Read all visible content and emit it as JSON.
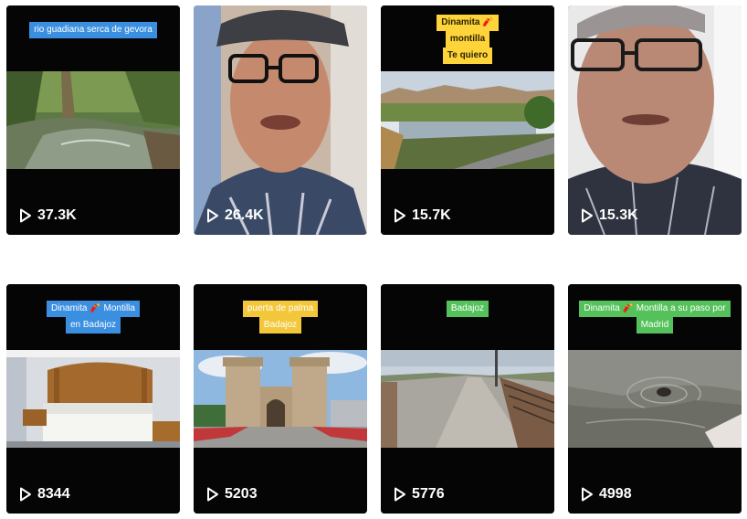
{
  "videos": [
    {
      "caption": [
        "rio guadiana serca de gevora"
      ],
      "caption_style": "blue",
      "views": "37.3K",
      "thumb": "river-forest"
    },
    {
      "caption": [],
      "caption_style": "",
      "views": "26.4K",
      "thumb": "man-selfie-cap"
    },
    {
      "caption": [
        "Dinamita 🧨",
        "montilla",
        "Te quiero"
      ],
      "caption_style": "yellow",
      "views": "15.7K",
      "thumb": "river-city"
    },
    {
      "caption": [],
      "caption_style": "",
      "views": "15.3K",
      "thumb": "man-selfie-close"
    },
    {
      "caption": [
        "Dinamita 🧨 Montilla",
        "en Badajoz"
      ],
      "caption_style": "blue",
      "views": "8344",
      "thumb": "hotel-bed"
    },
    {
      "caption": [
        "puerta de palma",
        "Badajoz"
      ],
      "caption_style": "gold",
      "views": "5203",
      "thumb": "puerta-palma"
    },
    {
      "caption": [
        "Badajoz"
      ],
      "caption_style": "green",
      "views": "5776",
      "thumb": "bridge"
    },
    {
      "caption": [
        "Dinamita 🧨 Montilla a su paso por",
        "Madrid"
      ],
      "caption_style": "green",
      "views": "4998",
      "thumb": "water-duck"
    }
  ],
  "icons": {
    "play": "play-icon"
  }
}
